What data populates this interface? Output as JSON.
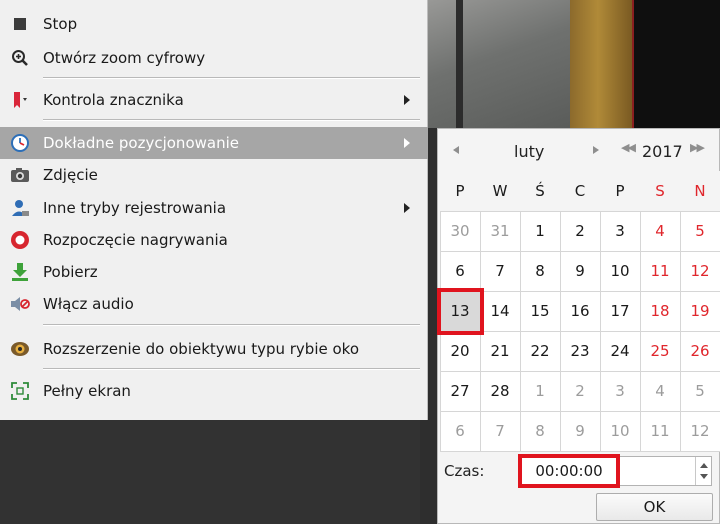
{
  "menu": {
    "items": [
      {
        "id": "stop",
        "label": "Stop",
        "icon": "stop-icon"
      },
      {
        "id": "digital-zoom",
        "label": "Otwórz zoom cyfrowy",
        "icon": "zoom-icon"
      },
      {
        "id": "marker-control",
        "label": "Kontrola znacznika",
        "icon": "bookmark-icon",
        "submenu": true
      },
      {
        "id": "precise-positioning",
        "label": "Dokładne pozycjonowanie",
        "icon": "clock-icon",
        "submenu": true,
        "highlighted": true
      },
      {
        "id": "snapshot",
        "label": "Zdjęcie",
        "icon": "camera-icon"
      },
      {
        "id": "other-recording-modes",
        "label": "Inne tryby rejestrowania",
        "icon": "user-icon",
        "submenu": true
      },
      {
        "id": "start-recording",
        "label": "Rozpoczęcie nagrywania",
        "icon": "record-icon"
      },
      {
        "id": "download",
        "label": "Pobierz",
        "icon": "download-icon"
      },
      {
        "id": "enable-audio",
        "label": "Włącz audio",
        "icon": "audio-icon"
      },
      {
        "id": "fisheye-expansion",
        "label": "Rozszerzenie do obiektywu typu rybie oko",
        "icon": "fisheye-icon"
      },
      {
        "id": "fullscreen",
        "label": "Pełny ekran",
        "icon": "fullscreen-icon"
      }
    ]
  },
  "calendar": {
    "month": "luty",
    "year": "2017",
    "weekdays": [
      "P",
      "W",
      "Ś",
      "C",
      "P",
      "S",
      "N"
    ],
    "weeks": [
      [
        "30",
        "31",
        "1",
        "2",
        "3",
        "4",
        "5"
      ],
      [
        "6",
        "7",
        "8",
        "9",
        "10",
        "11",
        "12"
      ],
      [
        "13",
        "14",
        "15",
        "16",
        "17",
        "18",
        "19"
      ],
      [
        "20",
        "21",
        "22",
        "23",
        "24",
        "25",
        "26"
      ],
      [
        "27",
        "28",
        "1",
        "2",
        "3",
        "4",
        "5"
      ],
      [
        "6",
        "7",
        "8",
        "9",
        "10",
        "11",
        "12"
      ]
    ],
    "selected_day": "13",
    "time_label": "Czas:",
    "time_value": "00:00:00",
    "ok_label": "OK"
  },
  "colors": {
    "weekend": "#e0262c",
    "highlight_box": "#e0141e",
    "menu_highlight": "#a6a6a6"
  }
}
